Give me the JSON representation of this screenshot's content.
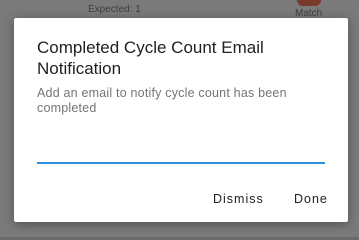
{
  "background": {
    "expected_text": "Expected: 1",
    "match_text": "Match"
  },
  "dialog": {
    "title": "Completed Cycle Count Email Notification",
    "message": "Add an email to notify cycle count has been completed",
    "email_value": "",
    "email_placeholder": "",
    "dismiss_label": "Dismiss",
    "done_label": "Done"
  },
  "colors": {
    "input_underline": "#2f8ed8",
    "scrim": "#7a7a7a"
  }
}
